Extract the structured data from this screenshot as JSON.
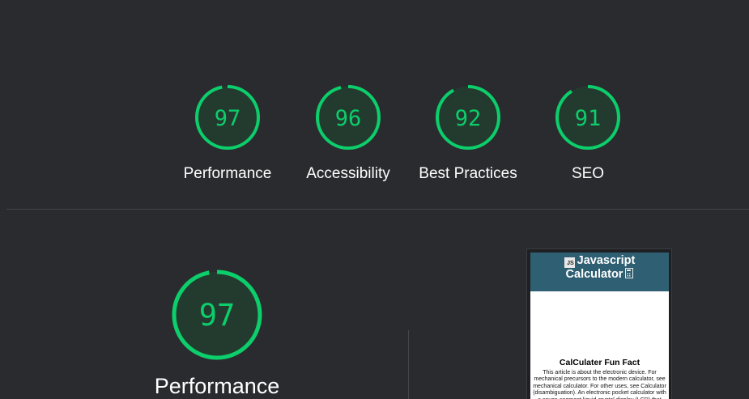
{
  "colors": {
    "background": "#2a2b2f",
    "pass_green": "#0cce6b",
    "gauge_fill": "#233b2f",
    "track": "#2f4a3c"
  },
  "scores": [
    {
      "value": "97",
      "label": "Performance",
      "fraction": 0.97
    },
    {
      "value": "96",
      "label": "Accessibility",
      "fraction": 0.96
    },
    {
      "value": "92",
      "label": "Best Practices",
      "fraction": 0.92
    },
    {
      "value": "91",
      "label": "SEO",
      "fraction": 0.91
    }
  ],
  "detail": {
    "value": "97",
    "label": "Performance",
    "fraction": 0.97
  },
  "screenshot": {
    "header_line1": "Javascript",
    "header_line2": "Calculator",
    "js_badge": "JS",
    "title": "CalCulater Fun Fact",
    "body": "This article is about the electronic device. For mechanical precursors to the modern calculator, see mechanical calculator. For other uses, see Calculator (disambiguation). An electronic pocket calculator with a seven-segment liquid-crystal display (LCD) that can perform arithmetic"
  }
}
